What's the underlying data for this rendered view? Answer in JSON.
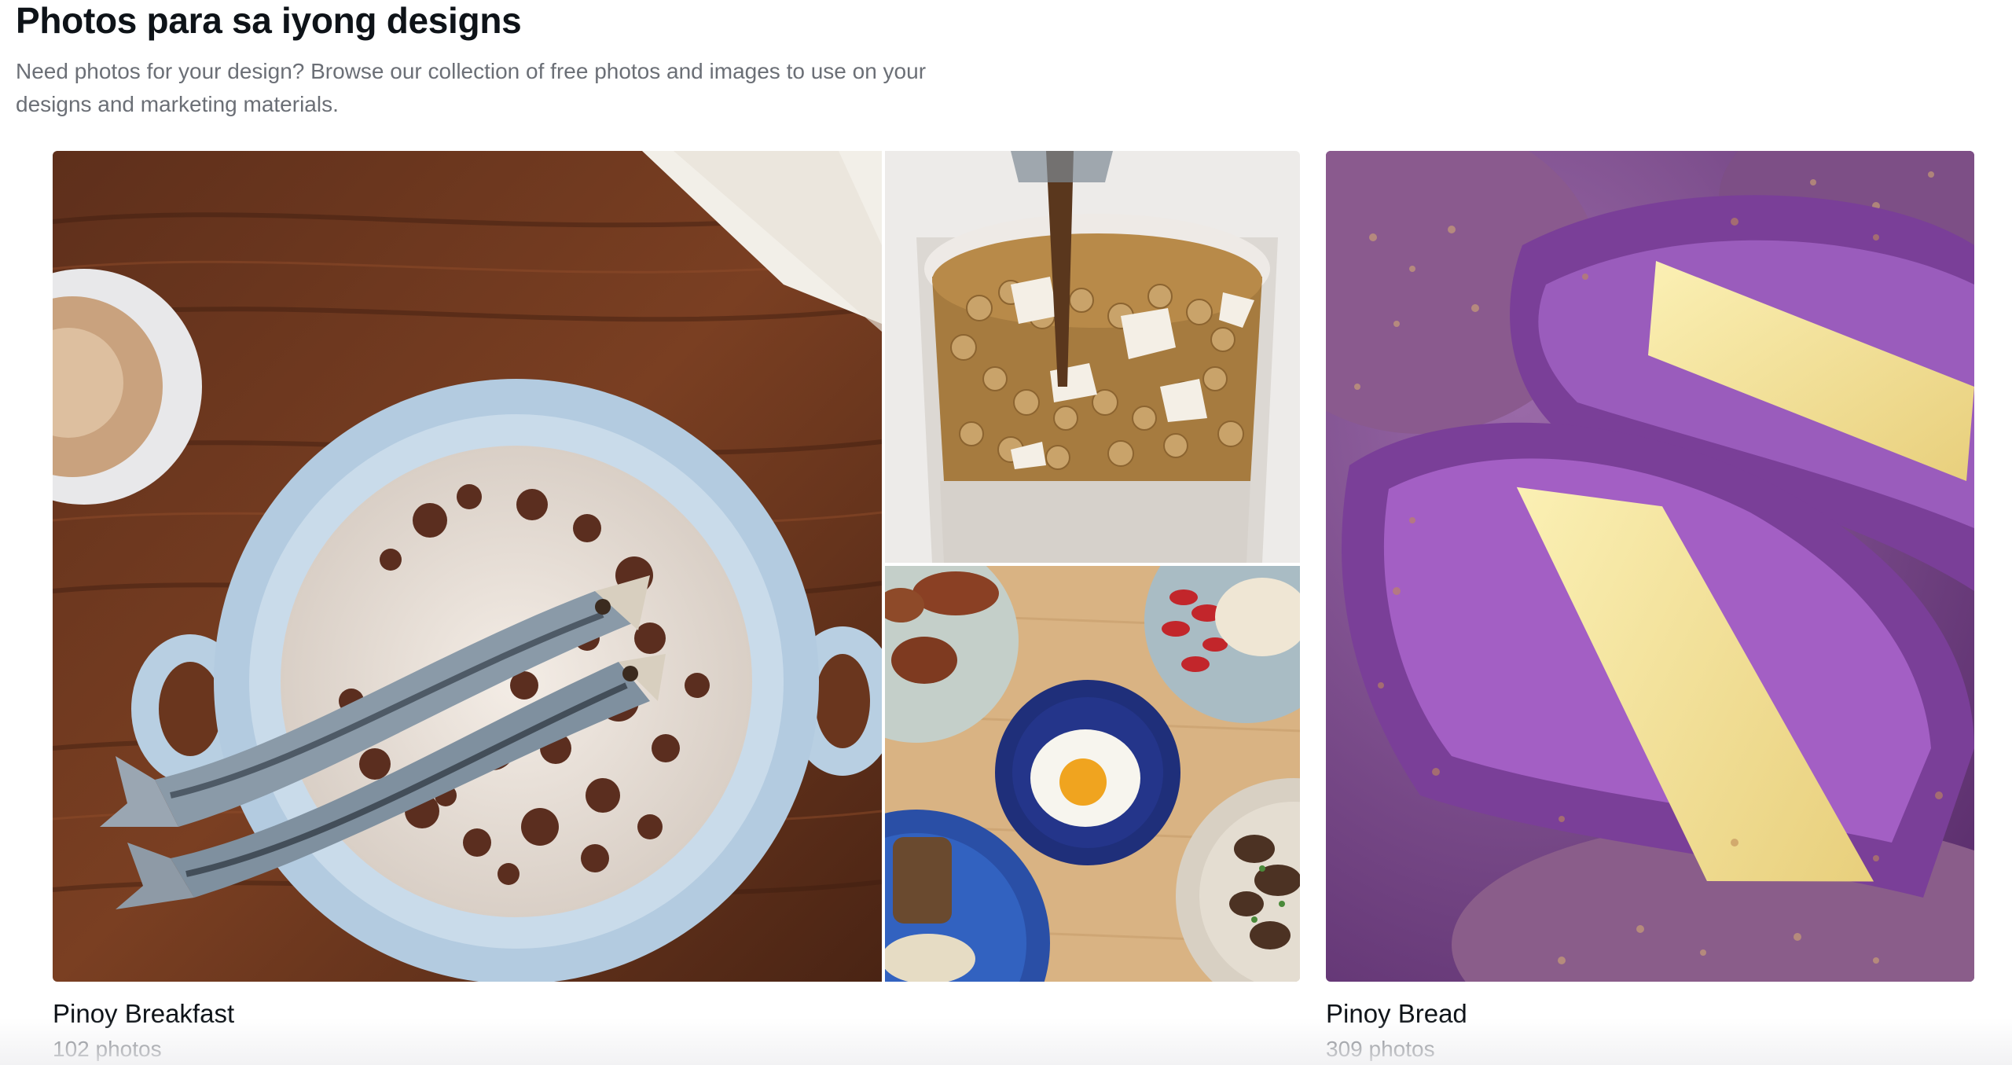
{
  "header": {
    "title": "Photos para sa iyong designs",
    "subtitle": "Need photos for your design? Browse our collection of free photos and images to use on your designs and marketing materials."
  },
  "collections": [
    {
      "name": "Pinoy Breakfast",
      "count": "102 photos",
      "images": [
        "champorado-with-tuyo-photo",
        "taho-drink-photo",
        "silog-plates-photo"
      ]
    },
    {
      "name": "Pinoy Bread",
      "count": "309 photos",
      "images": [
        "ube-cheese-pandesal-photo"
      ]
    }
  ],
  "colors": {
    "text_primary": "#0e1318",
    "text_secondary": "#6b6f76",
    "background": "#ffffff"
  }
}
